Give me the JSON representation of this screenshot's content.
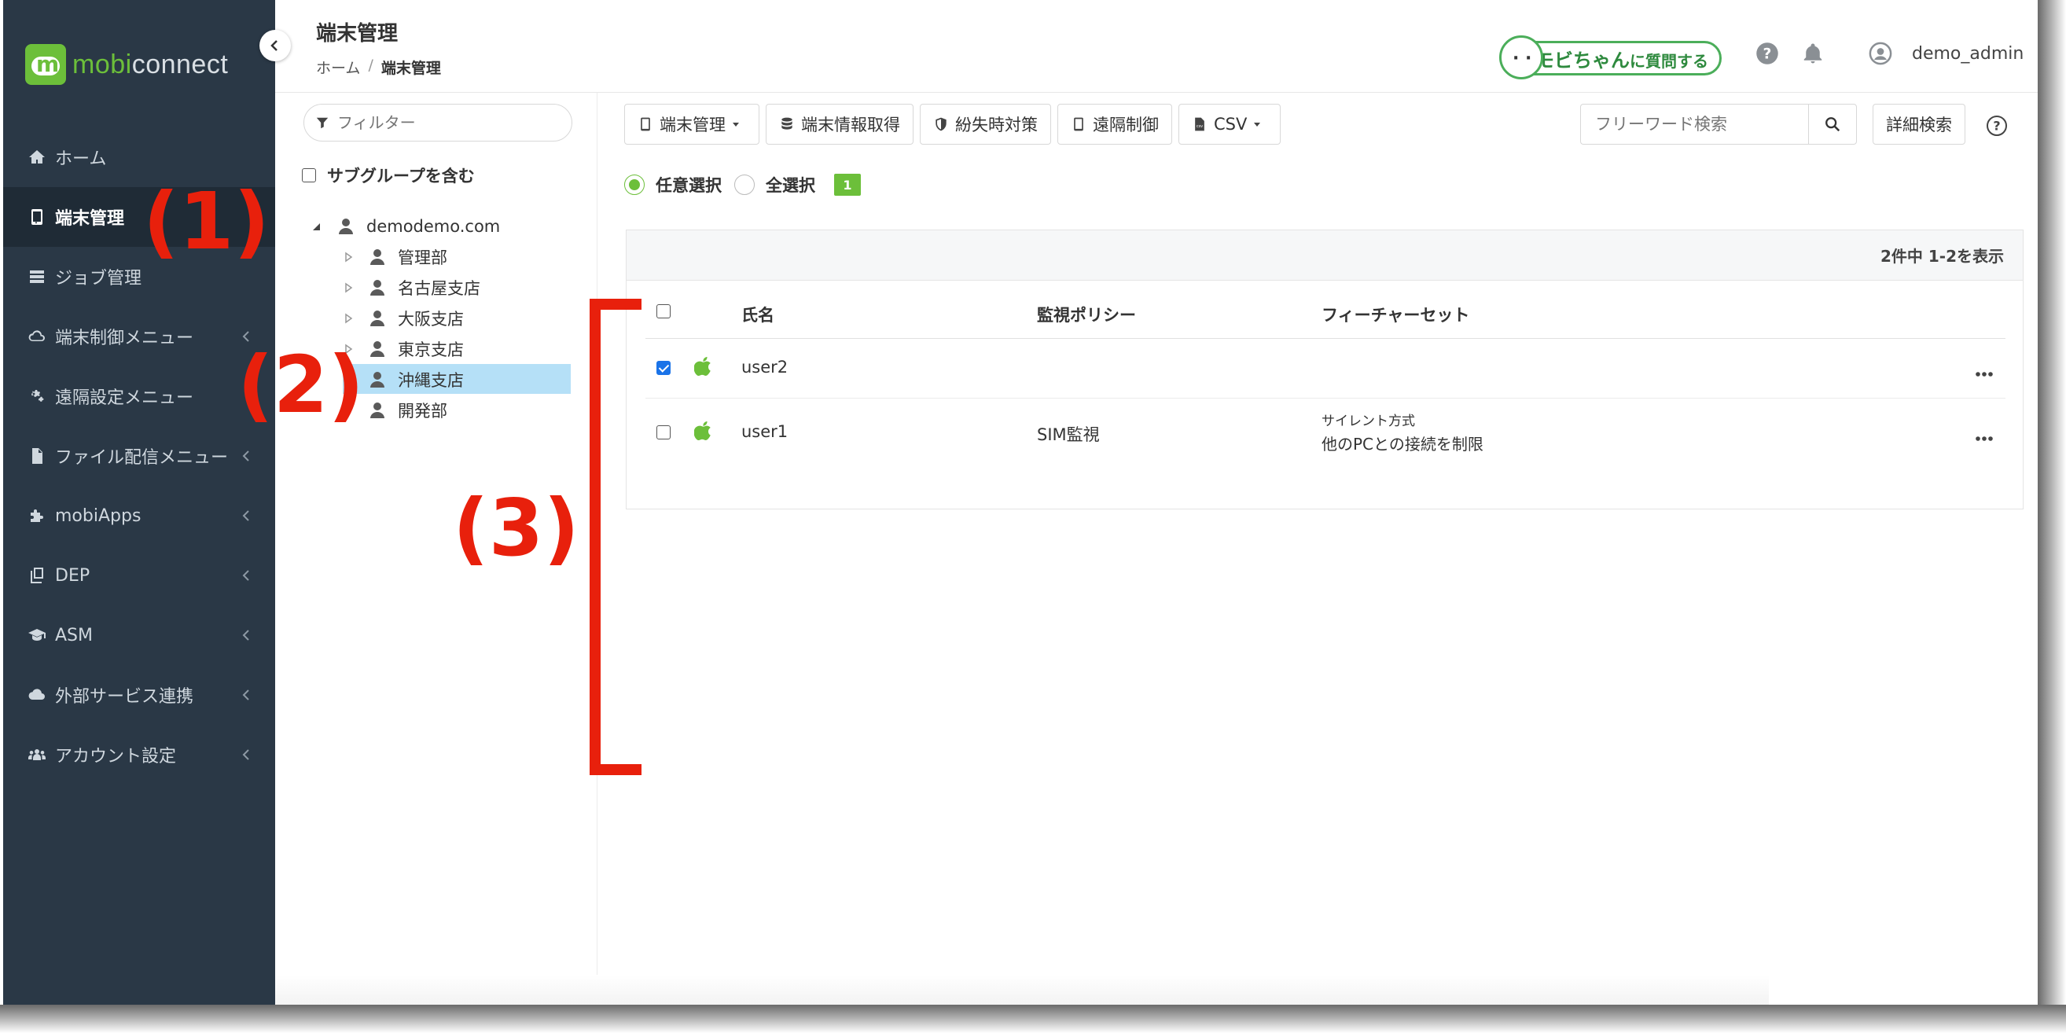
{
  "app": {
    "logo_text_a": "mobi",
    "logo_text_b": "connect"
  },
  "sidebar": {
    "items": [
      {
        "label": "ホーム",
        "icon": "home-icon",
        "active": false,
        "chevron": false
      },
      {
        "label": "端末管理",
        "icon": "mobile-icon",
        "active": true,
        "chevron": false
      },
      {
        "label": "ジョブ管理",
        "icon": "server-icon",
        "active": false,
        "chevron": false
      },
      {
        "label": "端末制御メニュー",
        "icon": "cloud-signal-icon",
        "active": false,
        "chevron": true
      },
      {
        "label": "遠隔設定メニュー",
        "icon": "gears-icon",
        "active": false,
        "chevron": false
      },
      {
        "label": "ファイル配信メニュー",
        "icon": "file-icon",
        "active": false,
        "chevron": true
      },
      {
        "label": "mobiApps",
        "icon": "puzzle-icon",
        "active": false,
        "chevron": true
      },
      {
        "label": "DEP",
        "icon": "copy-icon",
        "active": false,
        "chevron": true
      },
      {
        "label": "ASM",
        "icon": "graduation-cap-icon",
        "active": false,
        "chevron": true
      },
      {
        "label": "外部サービス連携",
        "icon": "cloud-icon",
        "active": false,
        "chevron": true
      },
      {
        "label": "アカウント設定",
        "icon": "users-icon",
        "active": false,
        "chevron": true
      }
    ]
  },
  "header": {
    "title": "端末管理",
    "breadcrumb": [
      "ホーム",
      "端末管理"
    ],
    "breadcrumb_sep": "/",
    "ai_badge": {
      "prefix": "AIモビちゃん",
      "suffix": "に質問する"
    },
    "username": "demo_admin"
  },
  "tree_panel": {
    "filter_placeholder": "フィルター",
    "include_subgroups_label": "サブグループを含む",
    "root": "demodemo.com",
    "groups": [
      {
        "label": "管理部",
        "selected": false
      },
      {
        "label": "名古屋支店",
        "selected": false
      },
      {
        "label": "大阪支店",
        "selected": false
      },
      {
        "label": "東京支店",
        "selected": false
      },
      {
        "label": "沖縄支店",
        "selected": true
      },
      {
        "label": "開発部",
        "selected": false
      }
    ]
  },
  "toolbar": {
    "buttons": [
      {
        "label": "端末管理",
        "icon": "mobile-icon",
        "dropdown": true
      },
      {
        "label": "端末情報取得",
        "icon": "database-icon",
        "dropdown": false
      },
      {
        "label": "紛失時対策",
        "icon": "shield-icon",
        "dropdown": false
      },
      {
        "label": "遠隔制御",
        "icon": "mobile-icon",
        "dropdown": false
      },
      {
        "label": "CSV",
        "icon": "csv-file-icon",
        "dropdown": true
      }
    ],
    "search_placeholder": "フリーワード検索",
    "advanced_search_label": "詳細検索"
  },
  "selection": {
    "arbitrary_label": "任意選択",
    "all_label": "全選択",
    "mode": "arbitrary",
    "count": "1"
  },
  "table": {
    "summary": "2件中 1-2を表示",
    "columns": [
      "氏名",
      "監視ポリシー",
      "フィーチャーセット"
    ],
    "rows": [
      {
        "checked": true,
        "os": "apple-icon",
        "name": "user2",
        "policy": "",
        "feature_set_line1": "",
        "feature_set_line2": ""
      },
      {
        "checked": false,
        "os": "apple-icon",
        "name": "user1",
        "policy": "SIM監視",
        "feature_set_line1": "サイレント方式",
        "feature_set_line2": "他のPCとの接続を制限"
      }
    ]
  },
  "annotations": {
    "a1": "(1)",
    "a2": "(2)",
    "a3": "(3)"
  },
  "colors": {
    "sidebar_bg": "#2a3846",
    "accent_green": "#6cbf3a",
    "annotation_red": "#e8200c",
    "tree_selected": "#b5e0f7",
    "checkbox_blue": "#1a73e8"
  }
}
